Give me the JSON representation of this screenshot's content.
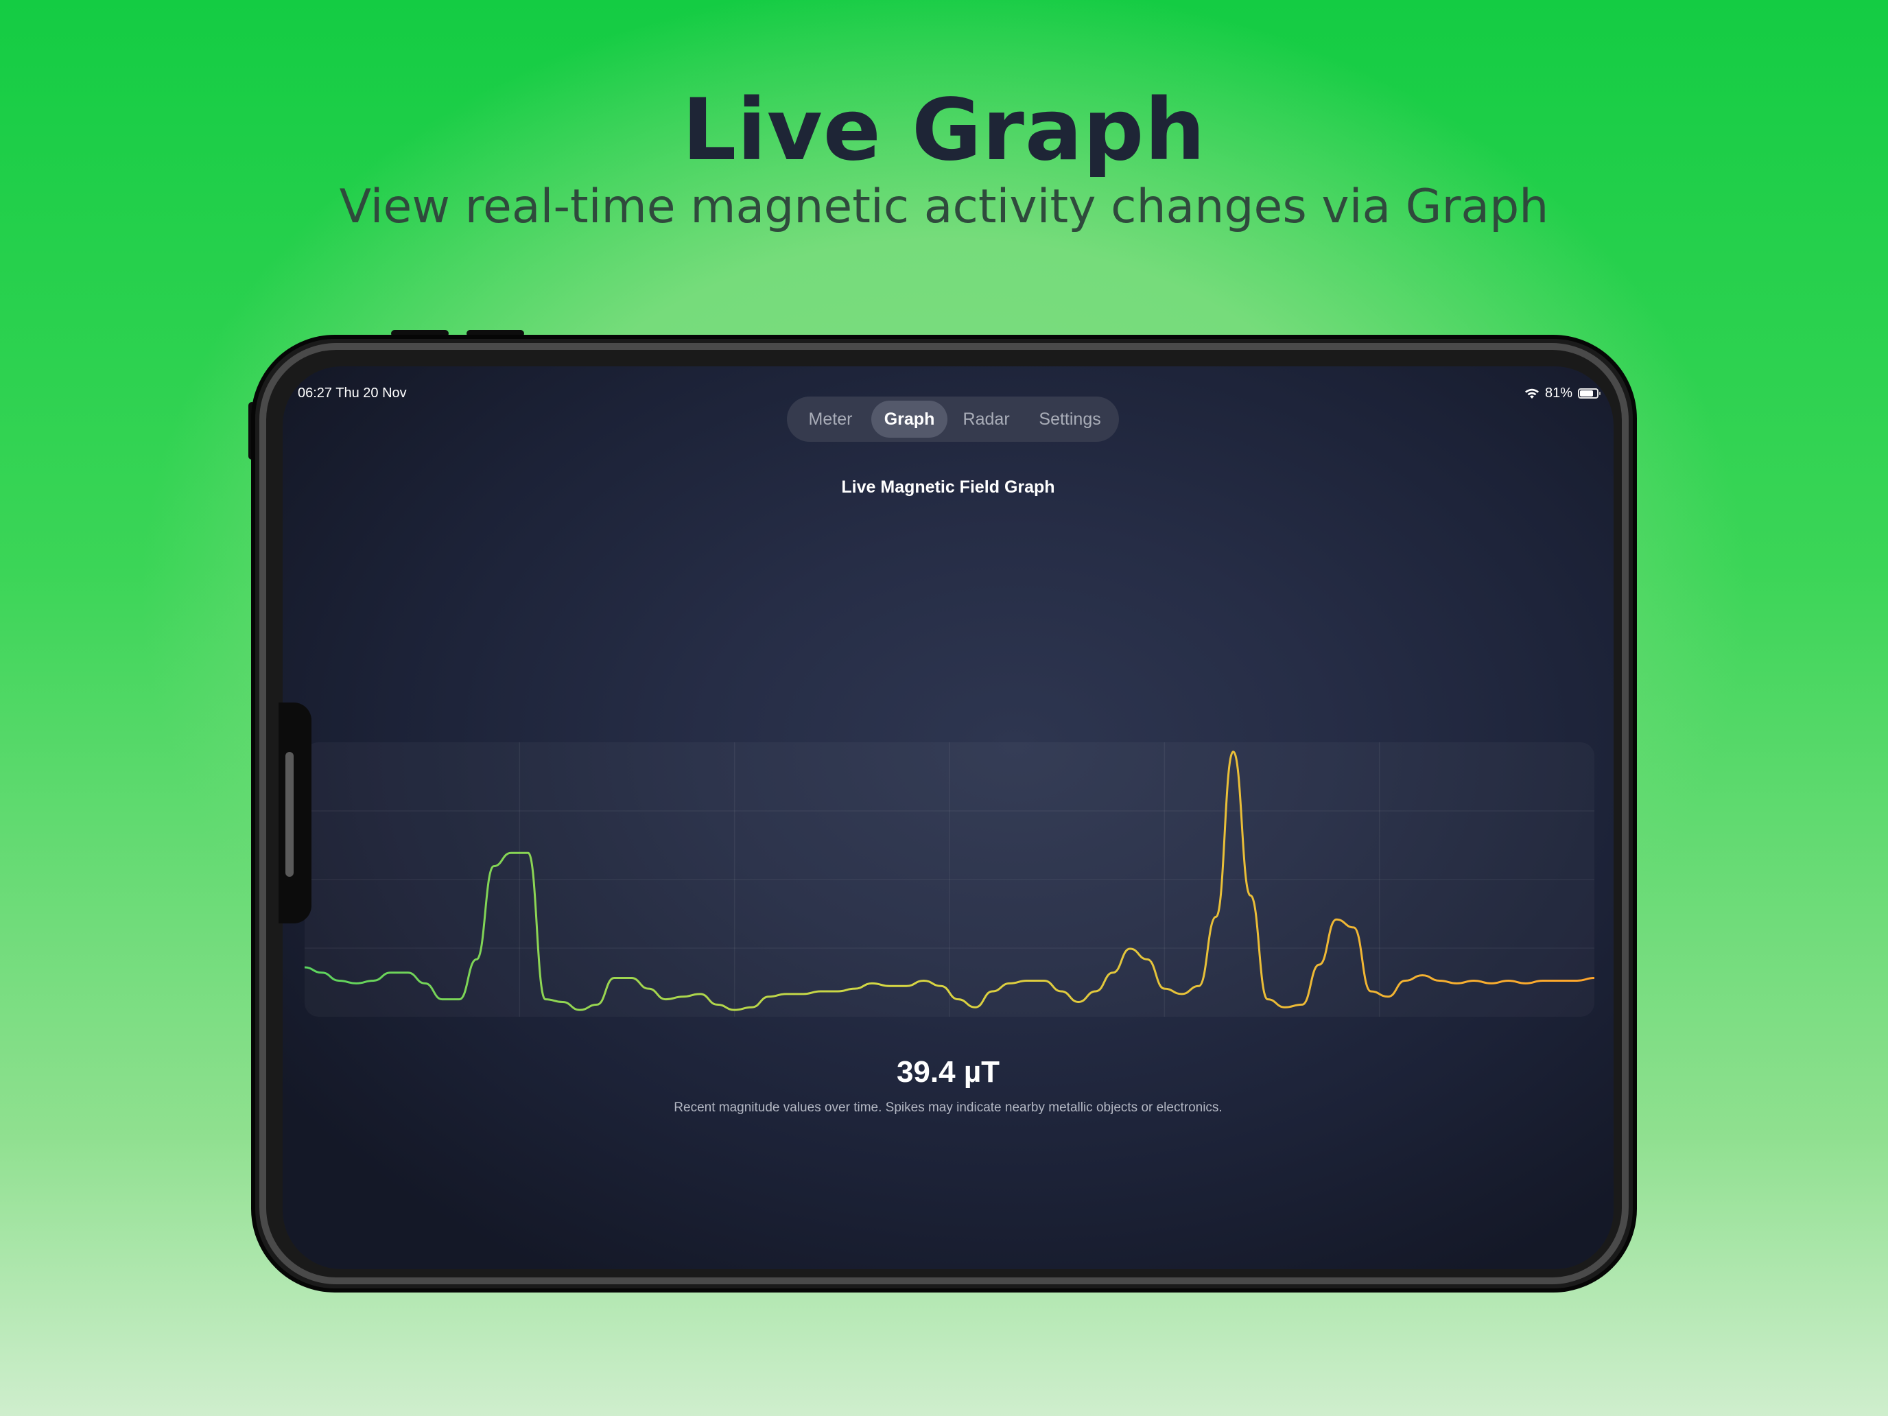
{
  "hero": {
    "title": "Live Graph",
    "subtitle": "View real-time magnetic activity changes via Graph"
  },
  "status_bar": {
    "time_date": "06:27  Thu 20 Nov",
    "battery": "81%",
    "wifi_icon": "wifi-icon",
    "battery_icon": "battery-icon",
    "battery_level": 0.81
  },
  "tabs": [
    {
      "label": "Meter",
      "active": false
    },
    {
      "label": "Graph",
      "active": true
    },
    {
      "label": "Radar",
      "active": false
    },
    {
      "label": "Settings",
      "active": false
    }
  ],
  "graph": {
    "heading": "Live Magnetic Field Graph",
    "reading": "39.4 µT",
    "caption": "Recent magnitude values over time. Spikes may indicate nearby metallic objects or electronics."
  },
  "colors": {
    "low": "#5bd45e",
    "mid": "#d5d744",
    "high": "#ffa62b",
    "panel": "#2a3048",
    "accent_bg": "#22c84a"
  },
  "chart_data": {
    "type": "line",
    "grid": true,
    "x": [
      0,
      4,
      8,
      12,
      16,
      20,
      24,
      28,
      32,
      36,
      40,
      44,
      48,
      52,
      56,
      60,
      64,
      68,
      72,
      76,
      80,
      84,
      88,
      92,
      96,
      100,
      104,
      108,
      112,
      116,
      120,
      124,
      128,
      132,
      136,
      140,
      144,
      148,
      152,
      156,
      160,
      164,
      168,
      172,
      176,
      180,
      184,
      188,
      192,
      196,
      200,
      204,
      208,
      212,
      216,
      220,
      224,
      228,
      232,
      236,
      240,
      244,
      248,
      252,
      256,
      260,
      264,
      268,
      272,
      276,
      280,
      284,
      288,
      292,
      296,
      300
    ],
    "values": [
      0.17,
      0.15,
      0.12,
      0.11,
      0.12,
      0.15,
      0.15,
      0.11,
      0.05,
      0.05,
      0.2,
      0.55,
      0.6,
      0.6,
      0.05,
      0.04,
      0.01,
      0.03,
      0.13,
      0.13,
      0.09,
      0.05,
      0.06,
      0.07,
      0.03,
      0.01,
      0.02,
      0.06,
      0.07,
      0.07,
      0.08,
      0.08,
      0.09,
      0.11,
      0.1,
      0.1,
      0.12,
      0.1,
      0.05,
      0.02,
      0.08,
      0.11,
      0.12,
      0.12,
      0.08,
      0.04,
      0.08,
      0.15,
      0.24,
      0.2,
      0.09,
      0.07,
      0.1,
      0.36,
      0.98,
      0.44,
      0.05,
      0.02,
      0.03,
      0.18,
      0.35,
      0.32,
      0.08,
      0.06,
      0.12,
      0.14,
      0.12,
      0.11,
      0.12,
      0.11,
      0.12,
      0.11,
      0.12,
      0.12,
      0.12,
      0.13
    ],
    "ylim": [
      0,
      1
    ]
  }
}
